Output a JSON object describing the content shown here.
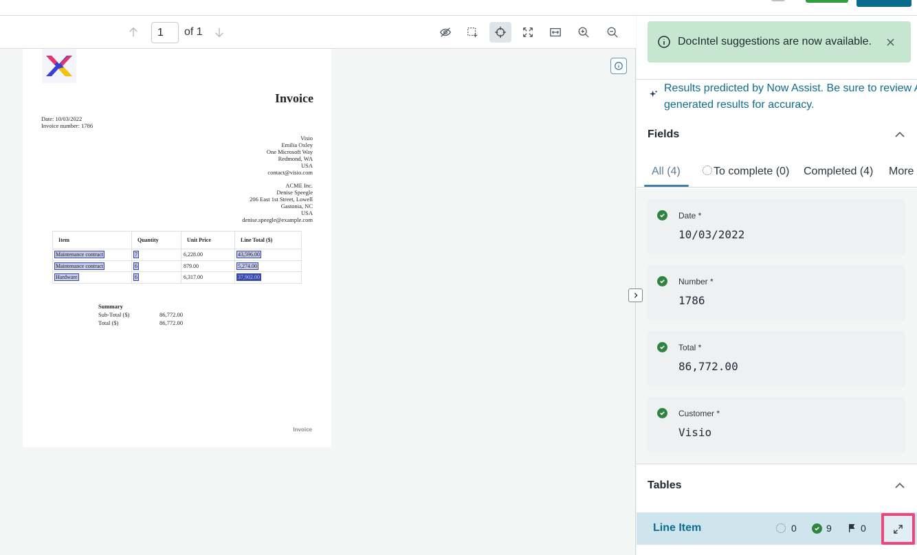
{
  "toolbar": {
    "page_value": "1",
    "page_of": "of 1",
    "icons": [
      "arrow-up-icon",
      "arrow-down-icon",
      "eye-off-icon",
      "region-select-icon",
      "crosshair-icon",
      "fit-page-icon",
      "fit-width-icon",
      "zoom-in-icon",
      "zoom-out-icon"
    ]
  },
  "document": {
    "title": "Invoice",
    "date_line": "Date: 10/03/2022",
    "invoice_number_line": "Invoice number: 1786",
    "vendor": [
      "Visio",
      "Emilia Oxley",
      "One Microsoft Way",
      "Redmond, WA",
      "USA",
      "contact@visio.com"
    ],
    "customer": [
      "ACME Inc.",
      "Denise Speegle",
      "206 East 1st Street, Lowell",
      "Gastonia, NC",
      "USA",
      "denise.speegle@example.com"
    ],
    "table_headers": [
      "Item",
      "Quantity",
      "Unit Price",
      "Line Total ($)"
    ],
    "rows": [
      {
        "item": "Maintenance contract",
        "qty": "7",
        "price": "6,228.00",
        "total": "43,596.00"
      },
      {
        "item": "Maintenance contract",
        "qty": "6",
        "price": "879.00",
        "total": "5,274.00"
      },
      {
        "item": "Hardware",
        "qty": "6",
        "price": "6,317.00",
        "total": "37,902.00"
      }
    ],
    "summary_title": "Summary",
    "subtotal_label": "Sub-Total ($)",
    "subtotal_value": "86,772.00",
    "total_label": "Total ($)",
    "total_value": "86,772.00",
    "footer": "Invoice"
  },
  "panel": {
    "notice": "DocIntel suggestions are now available.",
    "ai_note": "Results predicted by Now Assist. Be sure to review AI generated results for accuracy.",
    "fields_title": "Fields",
    "tabs": [
      {
        "label": "All (4)"
      },
      {
        "label": "To complete (0)"
      },
      {
        "label": "Completed (4)"
      },
      {
        "label": "More"
      }
    ],
    "fields": [
      {
        "label": "Date *",
        "value": "10/03/2022"
      },
      {
        "label": "Number *",
        "value": "1786"
      },
      {
        "label": "Total *",
        "value": "86,772.00"
      },
      {
        "label": "Customer *",
        "value": "Visio"
      }
    ],
    "tables_title": "Tables",
    "table_item": {
      "name": "Line Item",
      "incomplete": "0",
      "completed": "9",
      "flagged": "0"
    }
  },
  "colors": {
    "accent": "#0e6c8e",
    "success": "#2e8540",
    "notice_bg": "#c7e6cf",
    "highlight_border": "#f0457a"
  }
}
